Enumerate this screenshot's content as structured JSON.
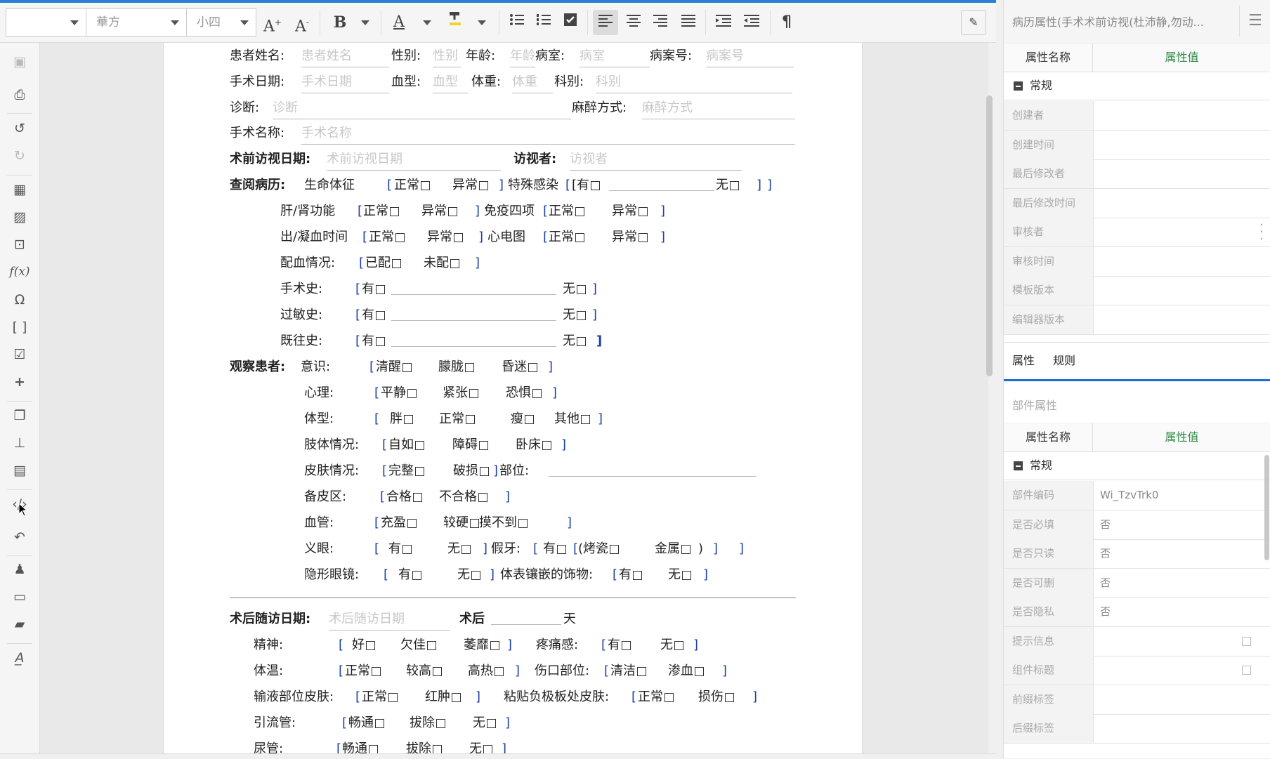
{
  "toolbar": {
    "font_name": "",
    "font_family": "華方",
    "font_size": "小四",
    "icons": [
      "font-grow-icon",
      "font-shrink-icon",
      "bold-icon",
      "font-color-icon",
      "highlight-icon",
      "bullet-list-icon",
      "numbered-list-icon",
      "checkbox-icon",
      "align-left-icon",
      "align-center-icon",
      "align-right-icon",
      "justify-icon",
      "indent-icon",
      "outdent-icon",
      "paragraph-mark-icon",
      "edit-note-icon"
    ]
  },
  "sidebar_icons": [
    "save-icon",
    "print-icon",
    "undo-icon",
    "redo-icon",
    "table-icon",
    "image-icon",
    "frame-icon",
    "formula-icon",
    "omega-icon",
    "bracket-icon",
    "checkbox-icon",
    "plus-icon",
    "copy-icon",
    "stamp-icon",
    "document-icon",
    "code-icon",
    "history-icon",
    "user-edit-icon",
    "id-card-icon",
    "comment-icon",
    "signature-icon"
  ],
  "document": {
    "l1": {
      "name_label": "患者姓名:",
      "name_ph": "患者姓名",
      "sex_label": "性别:",
      "sex_ph": "性别",
      "age_label": "年龄:",
      "age_ph": "年龄",
      "ward_label": "病室:",
      "ward_ph": "病室",
      "case_label": "病案号:",
      "case_ph": "病案号"
    },
    "l2": {
      "date_label": "手术日期:",
      "date_ph": "手术日期",
      "blood_label": "血型:",
      "blood_ph": "血型",
      "weight_label": "体重:",
      "weight_ph": "体重",
      "dept_label": "科别:",
      "dept_ph": "科别"
    },
    "l3": {
      "diag_label": "诊断:",
      "diag_ph": "诊断",
      "anes_label": "麻醉方式:",
      "anes_ph": "麻醉方式"
    },
    "l4": {
      "op_label": "手术名称:",
      "op_ph": "手术名称"
    },
    "l5": {
      "visit_label": "术前访视日期:",
      "visit_ph": "术前访视日期",
      "visitor_label": "访视者:",
      "visitor_ph": "访视者"
    },
    "l6": {
      "review": "查阅病历:",
      "vital": "生命体征",
      "normal": "正常",
      "abnormal": "异常",
      "infect": "特殊感染",
      "yes": "有",
      "no": "无"
    },
    "l7": {
      "liver": "肝/肾功能",
      "normal": "正常",
      "abnormal": "异常",
      "immune": "免疫四项"
    },
    "l8": {
      "bleed": "出/凝血时间",
      "normal": "正常",
      "abnormal": "异常",
      "ecg": "心电图"
    },
    "l9": {
      "blood_match": "配血情况:",
      "done": "已配",
      "notdone": "未配"
    },
    "l10": {
      "label": "手术史:",
      "yes": "有",
      "no": "无"
    },
    "l11": {
      "label": "过敏史:",
      "yes": "有",
      "no": "无"
    },
    "l12": {
      "label": "既往史:",
      "yes": "有",
      "no": "无"
    },
    "l13": {
      "observe": "观察患者:",
      "label": "意识:",
      "o1": "清醒",
      "o2": "朦胧",
      "o3": "昏迷"
    },
    "l14": {
      "label": "心理:",
      "o1": "平静",
      "o2": "紧张",
      "o3": "恐惧"
    },
    "l15": {
      "label": "体型:",
      "o1": "胖",
      "o2": "正常",
      "o3": "瘦",
      "o4": "其他"
    },
    "l16": {
      "label": "肢体情况:",
      "o1": "自如",
      "o2": "障碍",
      "o3": "卧床"
    },
    "l17": {
      "label": "皮肤情况:",
      "o1": "完整",
      "o2": "破损",
      "site": "部位:"
    },
    "l18": {
      "label": "备皮区:",
      "o1": "合格",
      "o2": "不合格"
    },
    "l19": {
      "label": "血管:",
      "o1": "充盈",
      "o2": "较硬",
      "o3": "摸不到"
    },
    "l20": {
      "label": "义眼:",
      "o1": "有",
      "o2": "无",
      "teeth": "假牙:",
      "t1": "有",
      "t2": "(烤瓷",
      "t3": "金属",
      "t4": ")"
    },
    "l21": {
      "label": "隐形眼镜:",
      "o1": "有",
      "o2": "无",
      "orn": "体表镶嵌的饰物:",
      "r1": "有",
      "r2": "无"
    },
    "l22": {
      "label": "术后随访日期:",
      "ph": "术后随访日期",
      "post": "术后",
      "days": "天"
    },
    "l23": {
      "label": "精神:",
      "o1": "好",
      "o2": "欠佳",
      "o3": "萎靡",
      "pain": "疼痛感:",
      "p1": "有",
      "p2": "无"
    },
    "l24": {
      "label": "体温:",
      "o1": "正常",
      "o2": "较高",
      "o3": "高热",
      "wound": "伤口部位:",
      "w1": "清洁",
      "w2": "渗血"
    },
    "l25": {
      "label": "输液部位皮肤:",
      "o1": "正常",
      "o2": "红肿",
      "plate": "粘贴负极板处皮肤:",
      "p1": "正常",
      "p2": "损伤"
    },
    "l26": {
      "label": "引流管:",
      "o1": "畅通",
      "o2": "拔除",
      "o3": "无"
    },
    "l27": {
      "label": "尿管:",
      "o1": "畅通",
      "o2": "拔除",
      "o3": "无"
    }
  },
  "panel": {
    "title": "病历属性(手术术前访视(杜沛静,勿动...",
    "col_name": "属性名称",
    "col_value": "属性值",
    "group1": "常规",
    "rows1": [
      {
        "name": "创建者",
        "value": ""
      },
      {
        "name": "创建时间",
        "value": ""
      },
      {
        "name": "最后修改者",
        "value": ""
      },
      {
        "name": "最后修改时间",
        "value": ""
      },
      {
        "name": "审核者",
        "value": ""
      },
      {
        "name": "审核时间",
        "value": ""
      },
      {
        "name": "模板版本",
        "value": ""
      },
      {
        "name": "编辑器版本",
        "value": ""
      }
    ],
    "tab_props": "属性",
    "tab_rules": "规则",
    "section": "部件属性",
    "col_name2": "属性名称",
    "col_value2": "属性值",
    "group2": "常规",
    "rows2": [
      {
        "name": "部件编码",
        "value": "Wi_TzvTrk0"
      },
      {
        "name": "是否必填",
        "value": "否"
      },
      {
        "name": "是否只读",
        "value": "否"
      },
      {
        "name": "是否可删",
        "value": "否"
      },
      {
        "name": "是否隐私",
        "value": "否"
      },
      {
        "name": "提示信息",
        "value": ""
      },
      {
        "name": "组件标题",
        "value": ""
      },
      {
        "name": "前缀标签",
        "value": ""
      },
      {
        "name": "后缀标签",
        "value": ""
      }
    ]
  }
}
